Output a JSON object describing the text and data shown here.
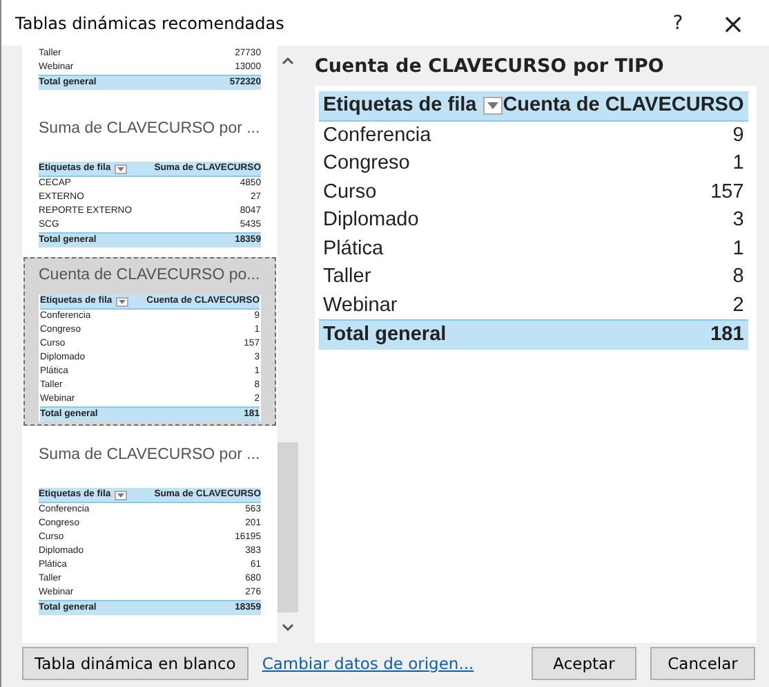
{
  "window": {
    "title": "Tablas dinámicas recomendadas",
    "help": "?",
    "close": "×"
  },
  "recommendations": [
    {
      "selected": false,
      "rows": [
        {
          "label": "Taller",
          "value": "27730"
        },
        {
          "label": "Webinar",
          "value": "13000"
        }
      ],
      "total": {
        "label": "Total general",
        "value": "572320"
      }
    },
    {
      "title": "Suma de CLAVECURSO por ...",
      "selected": false,
      "header": {
        "row_label": "Etiquetas de fila",
        "value_label": "Suma de CLAVECURSO"
      },
      "rows": [
        {
          "label": "CECAP",
          "value": "4850"
        },
        {
          "label": "EXTERNO",
          "value": "27"
        },
        {
          "label": "REPORTE EXTERNO",
          "value": "8047"
        },
        {
          "label": "SCG",
          "value": "5435"
        }
      ],
      "total": {
        "label": "Total general",
        "value": "18359"
      }
    },
    {
      "title": "Cuenta de CLAVECURSO po...",
      "selected": true,
      "header": {
        "row_label": "Etiquetas de fila",
        "value_label": "Cuenta de CLAVECURSO"
      },
      "rows": [
        {
          "label": "Conferencia",
          "value": "9"
        },
        {
          "label": "Congreso",
          "value": "1"
        },
        {
          "label": "Curso",
          "value": "157"
        },
        {
          "label": "Diplomado",
          "value": "3"
        },
        {
          "label": "Plática",
          "value": "1"
        },
        {
          "label": "Taller",
          "value": "8"
        },
        {
          "label": "Webinar",
          "value": "2"
        }
      ],
      "total": {
        "label": "Total general",
        "value": "181"
      }
    },
    {
      "title": "Suma de CLAVECURSO por ...",
      "selected": false,
      "header": {
        "row_label": "Etiquetas de fila",
        "value_label": "Suma de CLAVECURSO"
      },
      "rows": [
        {
          "label": "Conferencia",
          "value": "563"
        },
        {
          "label": "Congreso",
          "value": "201"
        },
        {
          "label": "Curso",
          "value": "16195"
        },
        {
          "label": "Diplomado",
          "value": "383"
        },
        {
          "label": "Plática",
          "value": "61"
        },
        {
          "label": "Taller",
          "value": "680"
        },
        {
          "label": "Webinar",
          "value": "276"
        }
      ],
      "total": {
        "label": "Total general",
        "value": "18359"
      }
    }
  ],
  "preview": {
    "title": "Cuenta de CLAVECURSO por TIPO",
    "header": {
      "row_label": "Etiquetas de fila",
      "value_label": "Cuenta de CLAVECURSO"
    },
    "rows": [
      {
        "label": "Conferencia",
        "value": "9"
      },
      {
        "label": "Congreso",
        "value": "1"
      },
      {
        "label": "Curso",
        "value": "157"
      },
      {
        "label": "Diplomado",
        "value": "3"
      },
      {
        "label": "Plática",
        "value": "1"
      },
      {
        "label": "Taller",
        "value": "8"
      },
      {
        "label": "Webinar",
        "value": "2"
      }
    ],
    "total": {
      "label": "Total general",
      "value": "181"
    }
  },
  "footer": {
    "blank_button": "Tabla dinámica en blanco",
    "change_link": "Cambiar datos de origen...",
    "ok_button": "Aceptar",
    "cancel_button": "Cancelar"
  }
}
